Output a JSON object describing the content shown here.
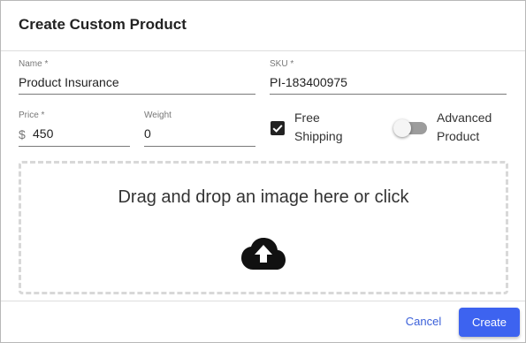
{
  "dialog": {
    "title": "Create Custom Product"
  },
  "form": {
    "name": {
      "label": "Name *",
      "value": "Product Insurance"
    },
    "sku": {
      "label": "SKU *",
      "value": "PI-183400975"
    },
    "price": {
      "label": "Price *",
      "prefix": "$",
      "value": "450"
    },
    "weight": {
      "label": "Weight",
      "value": "0"
    },
    "free_shipping": {
      "label_line1": "Free",
      "label_line2": "Shipping",
      "checked": true
    },
    "advanced_product": {
      "label_line1": "Advanced",
      "label_line2": "Product",
      "on": false
    }
  },
  "dropzone": {
    "text": "Drag and drop an image here or click",
    "icon": "cloud-upload-icon"
  },
  "actions": {
    "cancel_label": "Cancel",
    "create_label": "Create"
  },
  "colors": {
    "primary": "#3d63f0",
    "link": "#3a5fd9",
    "text": "#222222"
  }
}
